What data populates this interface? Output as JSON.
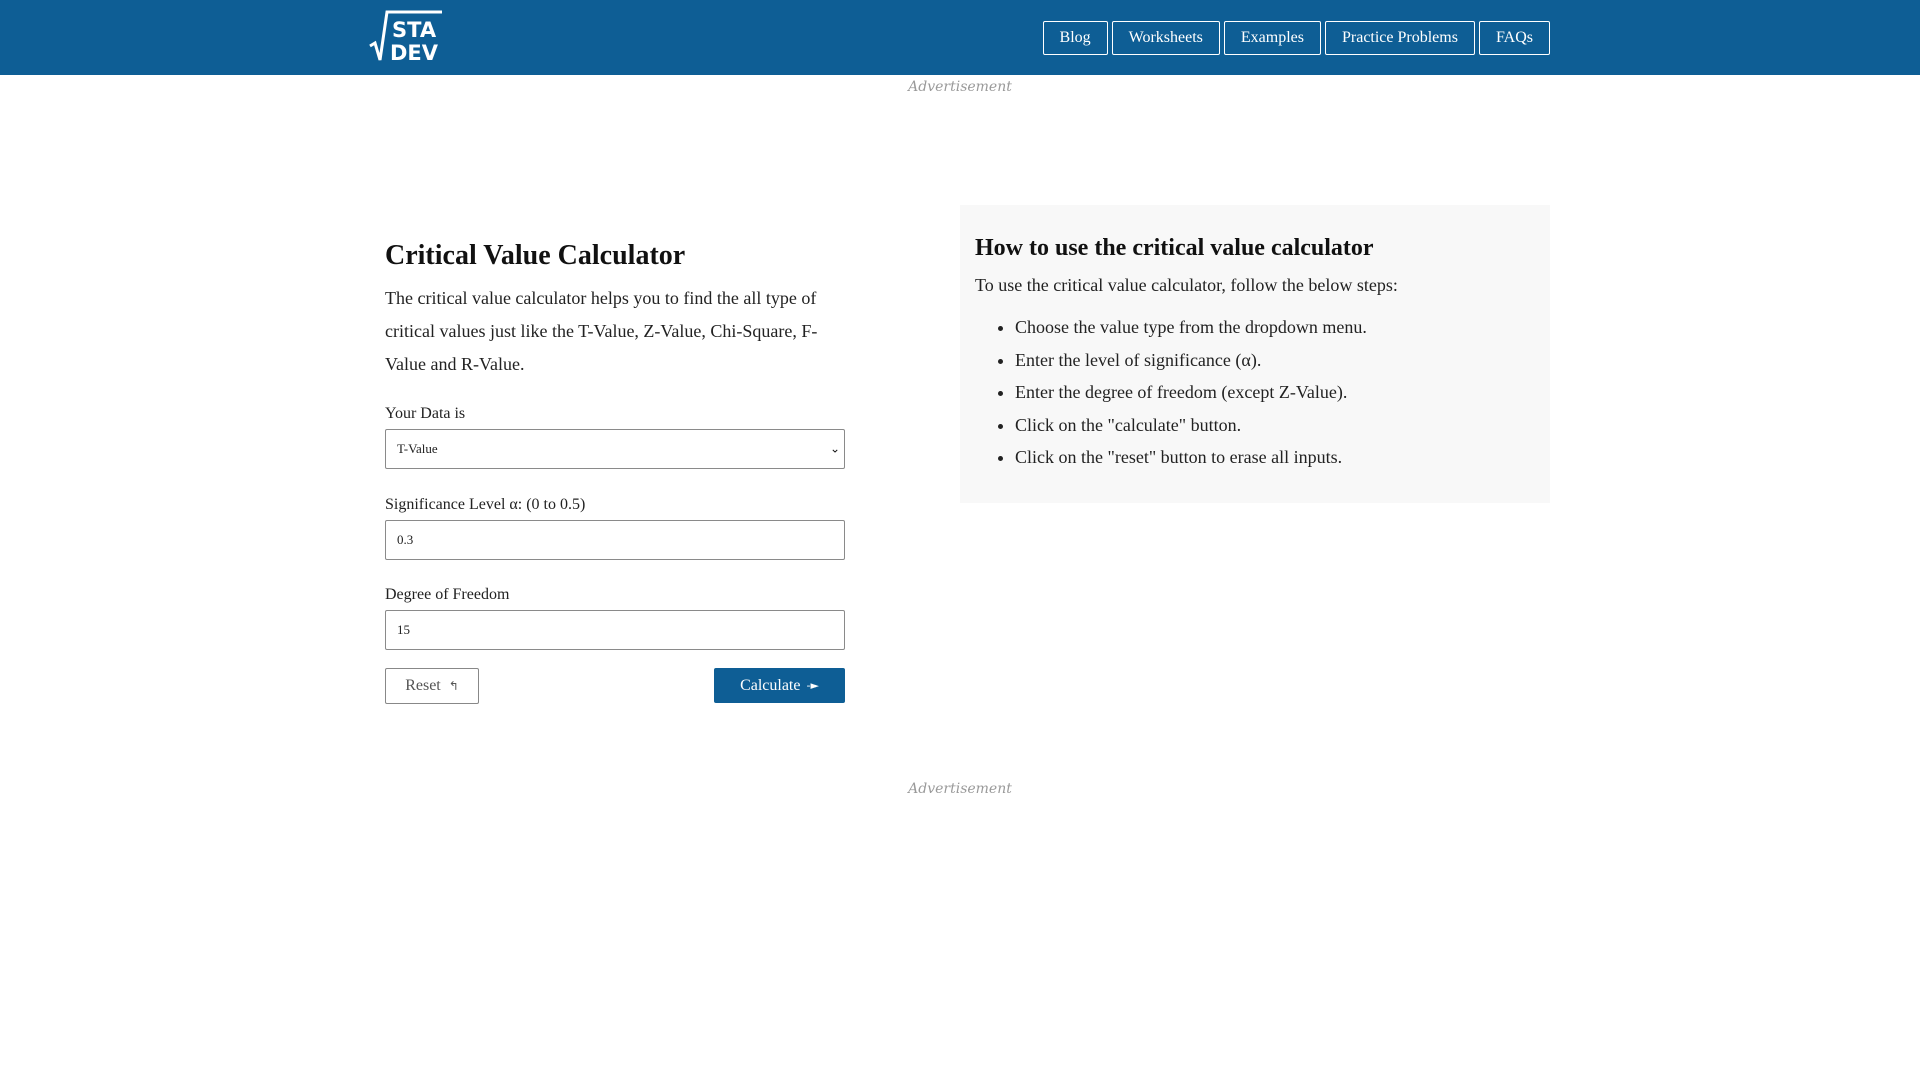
{
  "header": {
    "logo_text_top": "STA",
    "logo_text_bottom": "DEV",
    "nav": [
      "Blog",
      "Worksheets",
      "Examples",
      "Practice Problems",
      "FAQs"
    ],
    "brand_color": "#0e5e95"
  },
  "ads": {
    "top_label": "Advertisement",
    "bottom_label": "Advertisement"
  },
  "calculator": {
    "title": "Critical Value Calculator",
    "description": "The critical value calculator helps you to find the all type of critical values just like the T-Value, Z-Value, Chi-Square, F-Value and R-Value.",
    "data_type_label": "Your Data is",
    "data_type_value": "T-Value",
    "significance_label": "Significance Level α: (0 to 0.5)",
    "significance_value": "0.3",
    "dof_label": "Degree of Freedom",
    "dof_value": "15",
    "reset_label": "Reset",
    "reset_icon": "↰",
    "calculate_label": "Calculate",
    "calculate_icon": "-►"
  },
  "help": {
    "title": "How to use the critical value calculator",
    "intro": "To use the critical value calculator, follow the below steps:",
    "steps": [
      "Choose the value type from the dropdown menu.",
      "Enter the level of significance (α).",
      "Enter the degree of freedom (except Z-Value).",
      "Click on the \"calculate\" button.",
      "Click on the \"reset\" button to erase all inputs."
    ]
  }
}
